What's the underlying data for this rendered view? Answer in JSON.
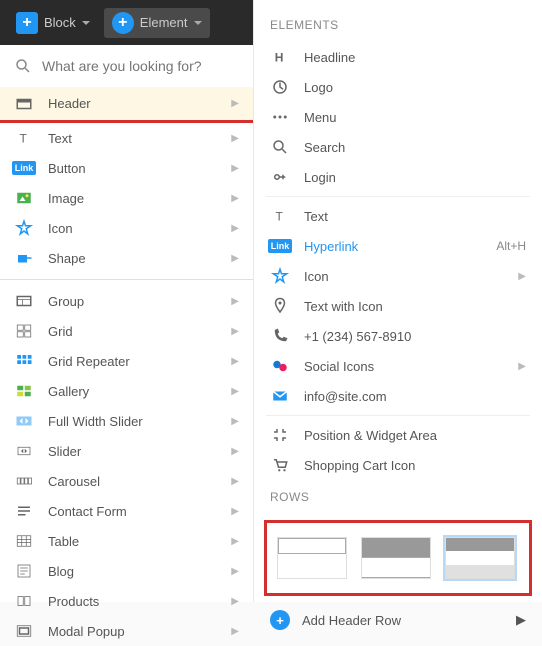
{
  "toolbar": {
    "block_label": "Block",
    "element_label": "Element"
  },
  "search": {
    "placeholder": "What are you looking for?"
  },
  "left_active": {
    "label": "Header"
  },
  "left_group_a": [
    {
      "id": "text",
      "label": "Text"
    },
    {
      "id": "button",
      "label": "Button"
    },
    {
      "id": "image",
      "label": "Image"
    },
    {
      "id": "icon",
      "label": "Icon"
    },
    {
      "id": "shape",
      "label": "Shape"
    }
  ],
  "left_group_b": [
    {
      "id": "group",
      "label": "Group"
    },
    {
      "id": "grid",
      "label": "Grid"
    },
    {
      "id": "grid-repeater",
      "label": "Grid Repeater"
    },
    {
      "id": "gallery",
      "label": "Gallery"
    },
    {
      "id": "full-width-slider",
      "label": "Full Width Slider"
    },
    {
      "id": "slider",
      "label": "Slider"
    },
    {
      "id": "carousel",
      "label": "Carousel"
    },
    {
      "id": "contact-form",
      "label": "Contact Form"
    },
    {
      "id": "table",
      "label": "Table"
    },
    {
      "id": "blog",
      "label": "Blog"
    },
    {
      "id": "products",
      "label": "Products"
    },
    {
      "id": "modal-popup",
      "label": "Modal Popup"
    }
  ],
  "elements_title": "ELEMENTS",
  "elements_a": [
    {
      "id": "headline",
      "label": "Headline"
    },
    {
      "id": "logo",
      "label": "Logo"
    },
    {
      "id": "menu",
      "label": "Menu"
    },
    {
      "id": "search",
      "label": "Search"
    },
    {
      "id": "login",
      "label": "Login"
    }
  ],
  "elements_b": [
    {
      "id": "text",
      "label": "Text",
      "expand": false
    },
    {
      "id": "hyperlink",
      "label": "Hyperlink",
      "shortcut": "Alt+H"
    },
    {
      "id": "icon",
      "label": "Icon",
      "expand": true
    },
    {
      "id": "text-with-icon",
      "label": "Text with Icon"
    },
    {
      "id": "phone",
      "label": "+1 (234) 567-8910"
    },
    {
      "id": "social-icons",
      "label": "Social Icons",
      "expand": true
    },
    {
      "id": "email",
      "label": "info@site.com"
    }
  ],
  "elements_c": [
    {
      "id": "position-widget",
      "label": "Position & Widget Area"
    },
    {
      "id": "shopping-cart",
      "label": "Shopping Cart Icon"
    }
  ],
  "rows_title": "ROWS",
  "add_row_label": "Add Header Row"
}
